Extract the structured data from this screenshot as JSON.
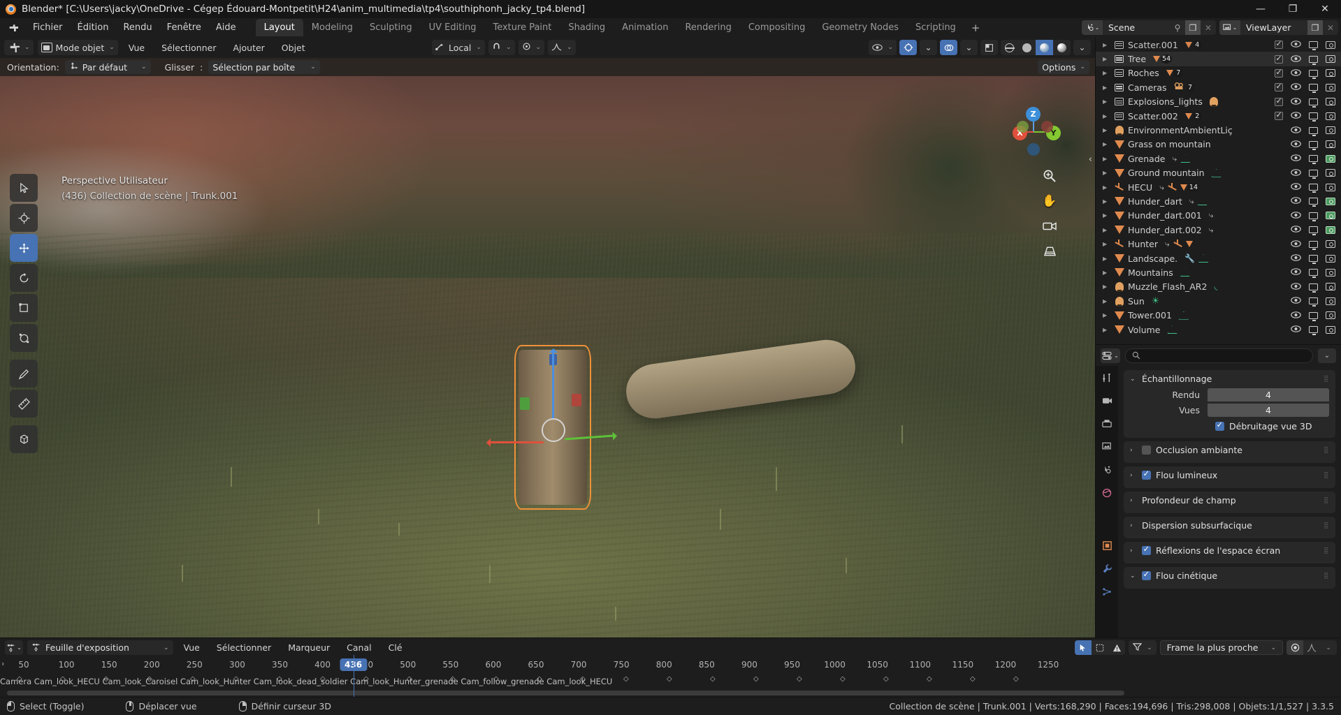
{
  "titlebar": {
    "title": "Blender* [C:\\Users\\jacky\\OneDrive - Cégep Édouard-Montpetit\\H24\\anim_multimedia\\tp4\\southiphonh_jacky_tp4.blend]",
    "minimize": "—",
    "maximize": "❐",
    "close": "✕"
  },
  "topbar": {
    "menus": [
      "Fichier",
      "Édition",
      "Rendu",
      "Fenêtre",
      "Aide"
    ],
    "workspaces": [
      "Layout",
      "Modeling",
      "Sculpting",
      "UV Editing",
      "Texture Paint",
      "Shading",
      "Animation",
      "Rendering",
      "Compositing",
      "Geometry Nodes",
      "Scripting"
    ],
    "active_workspace": "Layout",
    "add_workspace": "+",
    "scene_name": "Scene",
    "viewlayer_name": "ViewLayer"
  },
  "viewport_header": {
    "mode": "Mode objet",
    "menus": [
      "Vue",
      "Sélectionner",
      "Ajouter",
      "Objet"
    ],
    "transform_orientation": "Local"
  },
  "tool_settings": {
    "orientation_label": "Orientation:",
    "orientation_value": "Par défaut",
    "drag_label": "Glisser",
    "drag_colon": ":",
    "drag_value": "Sélection par boîte",
    "options_label": "Options"
  },
  "viewport": {
    "view_name": "Perspective Utilisateur",
    "active_object": "(436) Collection de scène | Trunk.001",
    "gizmo_axes": [
      "X",
      "Y",
      "Z"
    ]
  },
  "outliner": {
    "rows": [
      {
        "label": "Scatter.001",
        "icon": "collection-icon",
        "count": "4",
        "badge": "mesh",
        "restrict_check": true,
        "camera": "normal",
        "partial": true
      },
      {
        "label": "Tree",
        "icon": "collection-icon",
        "count": "54",
        "badge": "mesh",
        "restrict_check": true,
        "camera": "normal",
        "highlight": true
      },
      {
        "label": "Roches",
        "icon": "collection-icon",
        "count": "7",
        "badge": "mesh",
        "restrict_check": true,
        "camera": "normal"
      },
      {
        "label": "Cameras",
        "icon": "collection-icon",
        "count": "7",
        "badge": "camera",
        "restrict_check": true,
        "camera": "normal"
      },
      {
        "label": "Explosions_lights",
        "icon": "collection-icon",
        "count": "",
        "badge": "light",
        "restrict_check": true,
        "camera": "normal"
      },
      {
        "label": "Scatter.002",
        "icon": "collection-icon",
        "count": "2",
        "badge": "mesh",
        "restrict_check": true,
        "camera": "normal"
      },
      {
        "label": "EnvironmentAmbientLiç",
        "icon": "light-icon",
        "count": "",
        "badge": "",
        "camera": "normal"
      },
      {
        "label": "Grass on mountain",
        "icon": "mesh-icon",
        "count": "",
        "badge": "",
        "camera": "normal"
      },
      {
        "label": "Grenade",
        "icon": "mesh-icon",
        "count": "",
        "badge": "modifier-mesh",
        "camera": "green"
      },
      {
        "label": "Ground mountain",
        "icon": "mesh-icon",
        "count": "",
        "badge": "mesh-data",
        "camera": "normal"
      },
      {
        "label": "HECU",
        "icon": "armature-icon",
        "count": "14",
        "badge": "armature-group",
        "camera": "normal"
      },
      {
        "label": "Hunder_dart",
        "icon": "mesh-icon",
        "count": "",
        "badge": "modifier-mesh",
        "camera": "green"
      },
      {
        "label": "Hunder_dart.001",
        "icon": "mesh-icon",
        "count": "",
        "badge": "modifier",
        "camera": "green"
      },
      {
        "label": "Hunder_dart.002",
        "icon": "mesh-icon",
        "count": "",
        "badge": "modifier",
        "camera": "green"
      },
      {
        "label": "Hunter",
        "icon": "armature-icon",
        "count": "",
        "badge": "armature-group",
        "camera": "normal"
      },
      {
        "label": "Landscape.",
        "icon": "mesh-icon",
        "count": "",
        "badge": "wrench-mesh",
        "camera": "normal"
      },
      {
        "label": "Mountains",
        "icon": "mesh-icon",
        "count": "",
        "badge": "mesh-data",
        "camera": "normal"
      },
      {
        "label": "Muzzle_Flash_AR2",
        "icon": "light-icon",
        "count": "",
        "badge": "light-data",
        "camera": "normal"
      },
      {
        "label": "Sun",
        "icon": "light-icon",
        "count": "",
        "badge": "sun-data",
        "camera": "normal"
      },
      {
        "label": "Tower.001",
        "icon": "mesh-icon",
        "count": "",
        "badge": "mesh-data",
        "camera": "normal"
      },
      {
        "label": "Volume",
        "icon": "mesh-icon",
        "count": "",
        "badge": "mesh-data",
        "camera": "normal"
      }
    ]
  },
  "properties": {
    "search_placeholder": "",
    "panels": [
      {
        "title": "Échantillonnage",
        "expanded": true,
        "checkbox": null
      },
      {
        "title": "Occlusion ambiante",
        "expanded": false,
        "checkbox": false
      },
      {
        "title": "Flou lumineux",
        "expanded": false,
        "checkbox": true
      },
      {
        "title": "Profondeur de champ",
        "expanded": false,
        "checkbox": null
      },
      {
        "title": "Dispersion subsurfacique",
        "expanded": false,
        "checkbox": null
      },
      {
        "title": "Réflexions de l'espace écran",
        "expanded": false,
        "checkbox": true
      },
      {
        "title": "Flou cinétique",
        "expanded": true,
        "checkbox": true
      }
    ],
    "sampling": {
      "render_label": "Rendu",
      "render_value": "4",
      "viewport_label": "Vues",
      "viewport_value": "4",
      "denoise_label": "Débruitage vue 3D",
      "denoise_checked": true
    }
  },
  "timeline": {
    "editor_name": "Feuille d'exposition",
    "menus": [
      "Vue",
      "Sélectionner",
      "Marqueur",
      "Canal",
      "Clé"
    ],
    "snap_mode": "Frame la plus proche",
    "current_frame": "436",
    "ticks": [
      "50",
      "100",
      "150",
      "200",
      "250",
      "300",
      "350",
      "400",
      "450",
      "500",
      "550",
      "600",
      "650",
      "700",
      "750",
      "800",
      "850",
      "900",
      "950",
      "1000",
      "1050",
      "1100",
      "1150",
      "1200",
      "1250"
    ],
    "channel_text": "Camera Cam_look_HECU Cam_look_Caroisel Cam_look_Hunter Cam_look_dead_soldier Cam_look_Hunter_grenade Cam_follow_grenade Cam_look_HECU"
  },
  "statusbar": {
    "items": [
      {
        "mouse": "left",
        "label": "Select (Toggle)"
      },
      {
        "mouse": "middle",
        "label": "Déplacer vue"
      },
      {
        "mouse": "right",
        "label": "Définir curseur 3D"
      }
    ],
    "stats": "Collection de scène | Trunk.001 | Verts:168,290 | Faces:194,696 | Tris:298,008 | Objets:1/1,527 | 3.3.5"
  }
}
